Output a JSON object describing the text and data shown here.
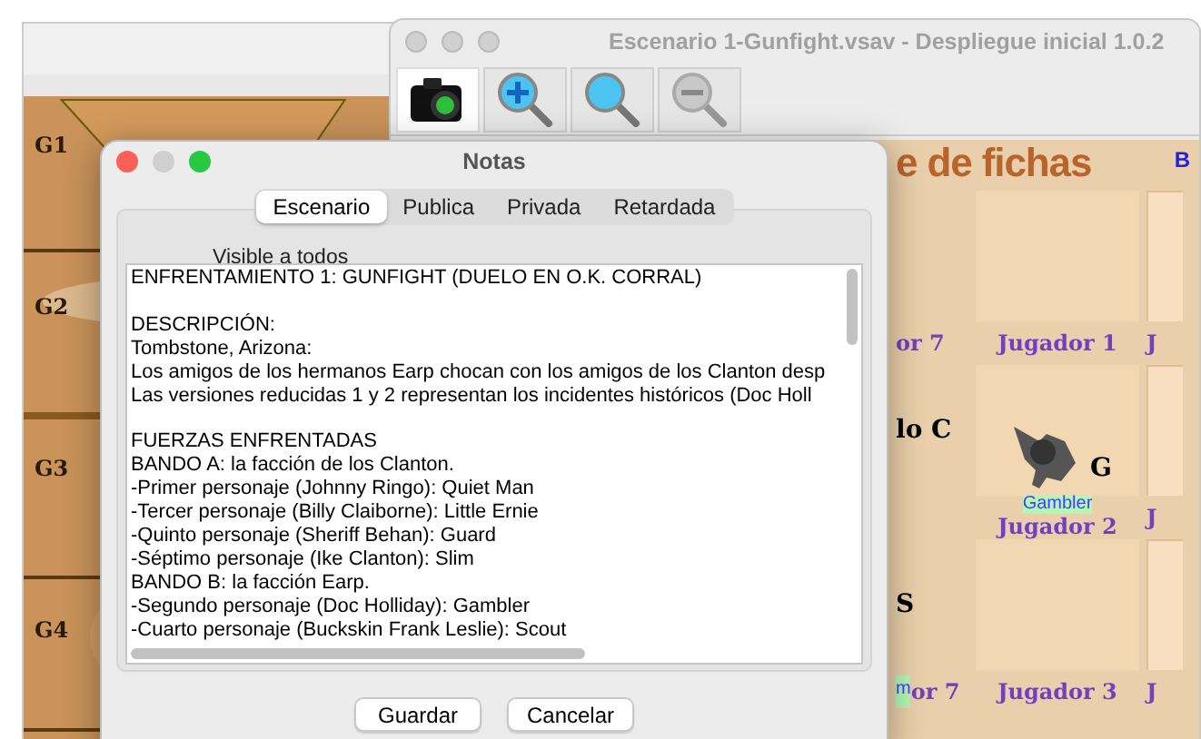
{
  "back_window": {
    "row_labels": [
      "G1",
      "G2",
      "G3",
      "G4"
    ]
  },
  "main_window": {
    "title": "Escenario 1-Gunfight.vsav - Despliegue inicial 1.0.2",
    "toolbar": [
      {
        "kind": "camera",
        "disabled": false
      },
      {
        "kind": "zoom_in",
        "disabled": false
      },
      {
        "kind": "zoom_fit",
        "disabled": false
      },
      {
        "kind": "zoom_out",
        "disabled": true
      }
    ],
    "board": {
      "heading": "e de fichas",
      "corner_label": "B",
      "rows": [
        {
          "label_left": "or 7",
          "middle": "Jugador 1",
          "right": "J"
        },
        {
          "tile_text": "lo C",
          "token": "G",
          "token_name": "Gambler",
          "middle": "Jugador 2",
          "right": "J"
        },
        {
          "tile_text": "S",
          "left_name": "m",
          "label_left": "or 7",
          "middle": "Jugador 3",
          "right": "J"
        }
      ]
    }
  },
  "dialog": {
    "title": "Notas",
    "tabs": [
      {
        "label": "Escenario",
        "selected": true
      },
      {
        "label": "Publica",
        "selected": false
      },
      {
        "label": "Privada",
        "selected": false
      },
      {
        "label": "Retardada",
        "selected": false
      }
    ],
    "visibility_label": "Visible a todos",
    "paragraphs": [
      [
        "ENFRENTAMIENTO 1: GUNFIGHT (DUELO EN O.K. CORRAL)"
      ],
      [
        "DESCRIPCIÓN:",
        "Tombstone, Arizona:",
        "Los amigos de los hermanos Earp chocan con los amigos de los Clanton desp",
        "Las versiones reducidas 1 y 2 representan los incidentes históricos (Doc Holl"
      ],
      [
        "FUERZAS ENFRENTADAS",
        "BANDO A: la facción de los Clanton.",
        "-Primer personaje (Johnny Ringo): Quiet Man",
        "-Tercer personaje (Billy Claiborne): Little Ernie",
        "-Quinto personaje (Sheriff Behan): Guard",
        "-Séptimo personaje (Ike Clanton): Slim",
        "BANDO B: la facción Earp.",
        "-Segundo personaje (Doc Holliday): Gambler",
        "-Cuarto personaje (Buckskin Frank Leslie): Scout"
      ]
    ],
    "buttons": [
      "Guardar",
      "Cancelar"
    ]
  }
}
